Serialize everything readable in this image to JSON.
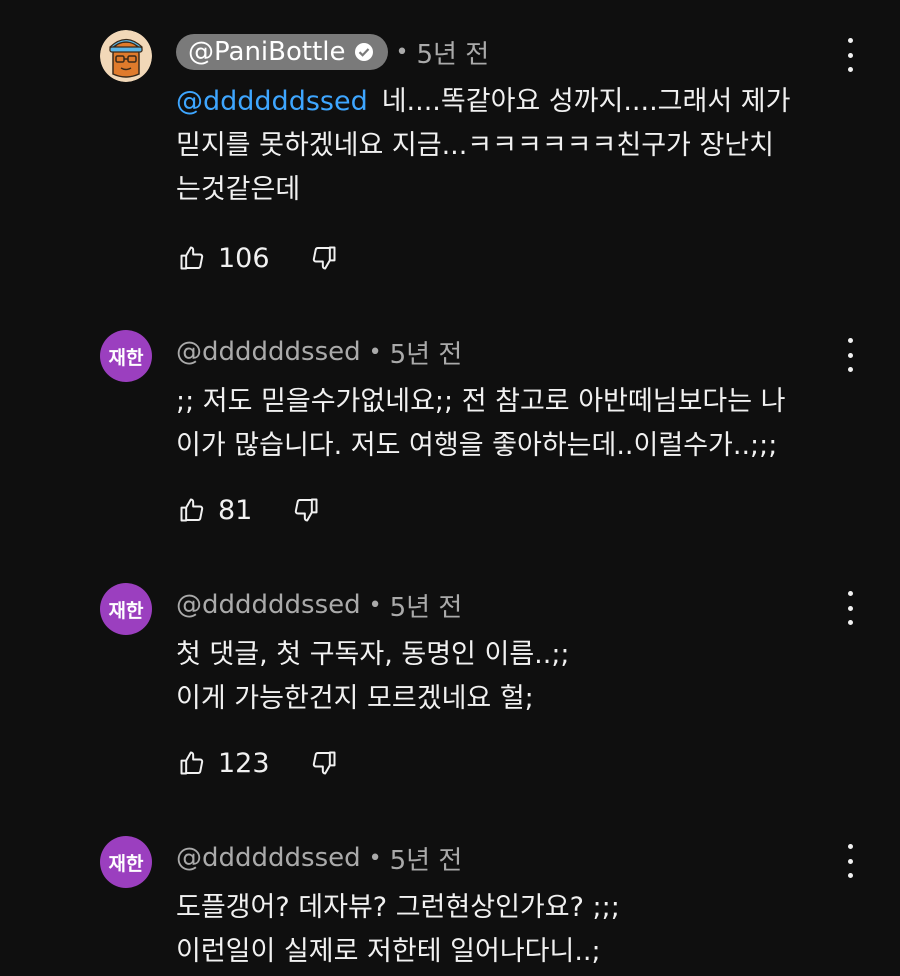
{
  "comments": [
    {
      "author": "@PaniBottle",
      "verified": true,
      "time": "5년 전",
      "mention": "@ddddddssed",
      "lines": [
        "네....똑같아요 성까지....그래서 제가",
        "믿지를 못하겠네요 지금...ㅋㅋㅋㅋㅋㅋ친구가 장난치",
        "는것같은데"
      ],
      "likes": "106"
    },
    {
      "author": "@ddddddssed",
      "avatar_initials": "재한",
      "time": "5년 전",
      "lines": [
        ";; 저도 믿을수가없네요;; 전 참고로 아반떼님보다는 나",
        "이가 많습니다. 저도 여행을 좋아하는데..이럴수가..;;;"
      ],
      "likes": "81"
    },
    {
      "author": "@ddddddssed",
      "avatar_initials": "재한",
      "time": "5년 전",
      "lines": [
        "첫 댓글, 첫 구독자, 동명인 이름..;;",
        "이게 가능한건지 모르겠네요 헐;"
      ],
      "likes": "123"
    },
    {
      "author": "@ddddddssed",
      "avatar_initials": "재한",
      "time": "5년 전",
      "lines": [
        "도플갱어? 데자뷰? 그런현상인가요? ;;;",
        "이런일이 실제로 저한테 일어나다니..;"
      ]
    }
  ],
  "separator": "•",
  "icons": {
    "like": "thumb-up-icon",
    "dislike": "thumb-down-icon",
    "more": "more-vert-icon",
    "verified": "verified-check-icon"
  },
  "colors": {
    "background": "#0f0f0f",
    "mention": "#3ea6ff",
    "avatar_purple": "#9b3fbf",
    "pill": "#7a7a7a"
  }
}
